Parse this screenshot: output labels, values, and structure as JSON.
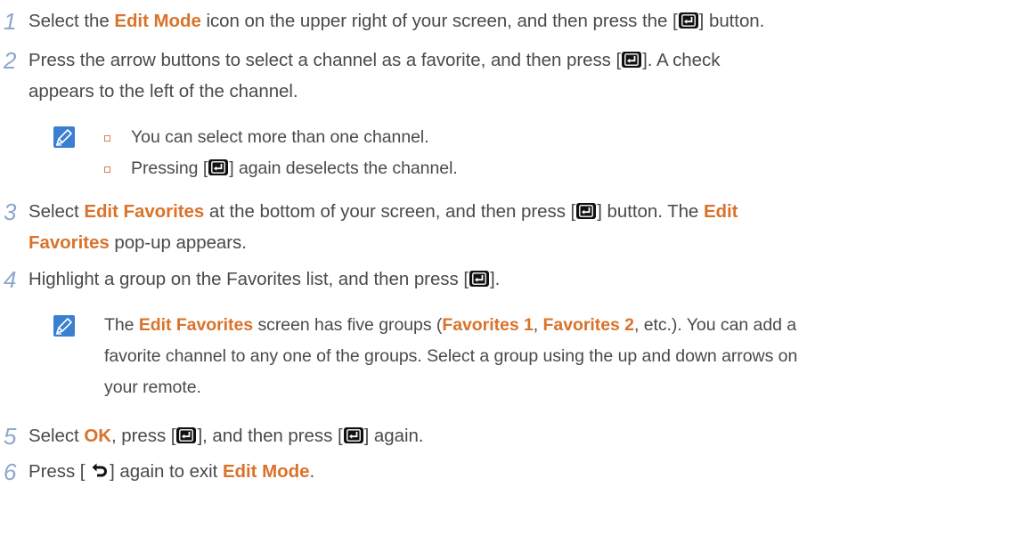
{
  "accent_color": "#d9732b",
  "step_number_color": "#8da6cc",
  "steps": {
    "s1": {
      "num": "1",
      "t1": "Select the ",
      "b1": "Edit Mode",
      "t2": " icon on the upper right of your screen, and then press the [",
      "t3": "] button."
    },
    "s2": {
      "num": "2",
      "t1": "Press the arrow buttons to select a channel as a favorite, and then press [",
      "t2": "]. A check",
      "t3": "appears to the left of the channel."
    },
    "s2_notes": [
      {
        "text": "You can select more than one channel."
      },
      {
        "t1": "Pressing [",
        "t2": "] again deselects the channel."
      }
    ],
    "s3": {
      "num": "3",
      "t1": "Select ",
      "b1": "Edit Favorites",
      "t2": " at the bottom of your screen, and then press [",
      "t3": "] button. The ",
      "b2": "Edit",
      "b3": "Favorites",
      "t4": " pop-up appears."
    },
    "s4": {
      "num": "4",
      "t1": "Highlight a group on the Favorites list, and then press [",
      "t2": "]."
    },
    "s4_note": {
      "t1": "The ",
      "b1": "Edit Favorites",
      "t2": " screen has five groups (",
      "b2": "Favorites 1",
      "t3": ", ",
      "b3": "Favorites 2",
      "t4": ", etc.). You can add a",
      "line2": "favorite channel to any one of the groups. Select a group using the up and down arrows on",
      "line3": "your remote."
    },
    "s5": {
      "num": "5",
      "t1": "Select ",
      "b1": "OK",
      "t2": ", press [",
      "t3": "], and then press [",
      "t4": "] again."
    },
    "s6": {
      "num": "6",
      "t1": "Press [ ",
      "t2": "] again to exit ",
      "b1": "Edit Mode",
      "t3": "."
    }
  },
  "icons": {
    "enter_key": "enter-key-icon",
    "return_key": "return-key-icon",
    "note": "note-pencil-icon",
    "bullet": "square-bullet-icon"
  }
}
